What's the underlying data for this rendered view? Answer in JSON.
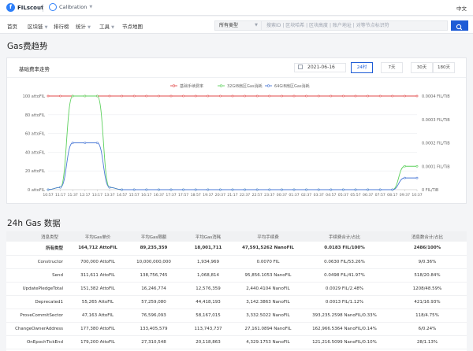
{
  "brand": {
    "name": "FILscout"
  },
  "network": {
    "label": "Calibration"
  },
  "lang": "中文",
  "nav": [
    "首页",
    "区块链",
    "排行榜",
    "统计",
    "工具",
    "节点地图"
  ],
  "search": {
    "type": "所有类型",
    "placeholder": "搜索ID | 区块哈希 | 区块高度 | 账户地址 | 对等节点标识符"
  },
  "gas_trend": {
    "title": "Gas费趋势",
    "chart_title": "基础费率走势",
    "date": "2021-06-16",
    "ranges": [
      "24时",
      "7天",
      "30天",
      "180天"
    ],
    "active_range": "24时"
  },
  "chart_data": {
    "type": "line",
    "x": [
      "10:57",
      "11:17",
      "11:37",
      "12:17",
      "13:17",
      "13:37",
      "14:57",
      "15:57",
      "16:17",
      "16:37",
      "17:37",
      "17:57",
      "18:57",
      "19:37",
      "20:37",
      "21:17",
      "22:37",
      "22:57",
      "23:37",
      "00:37",
      "01:37",
      "02:37",
      "03:37",
      "04:57",
      "05:37",
      "05:57",
      "06:37",
      "07:57",
      "08:17",
      "09:37",
      "10:37"
    ],
    "series": [
      {
        "name": "基础手续费率",
        "axis": "right",
        "unit": "FIL/TiB",
        "color": "#e24a4a",
        "values": [
          0.0004,
          0.0004,
          0.0004,
          0.0004,
          0.0004,
          0.0004,
          0.0004,
          0.0004,
          0.0004,
          0.0004,
          0.0004,
          0.0004,
          0.0004,
          0.0004,
          0.0004,
          0.0004,
          0.0004,
          0.0004,
          0.0004,
          0.0004,
          0.0004,
          0.0004,
          0.0004,
          0.0004,
          0.0004,
          0.0004,
          0.0004,
          0.0004,
          0.0004,
          0.0004,
          0.0004
        ]
      },
      {
        "name": "32GiB扇区Gas消耗",
        "axis": "right",
        "unit": "FIL/TiB",
        "color": "#5cd05c",
        "values": [
          0,
          1e-05,
          0.0004,
          0.0004,
          0.0004,
          1e-05,
          0,
          0,
          0,
          0,
          0,
          0,
          0,
          0,
          0,
          0,
          0,
          0,
          0,
          0,
          0,
          0,
          0,
          0,
          0,
          0,
          0,
          0,
          0,
          0.0001,
          0.0001
        ]
      },
      {
        "name": "64GiB扇区Gas消耗",
        "axis": "right",
        "unit": "FIL/TiB",
        "color": "#4a78d6",
        "values": [
          0,
          1e-05,
          0.0002,
          0.0002,
          0.0002,
          1e-05,
          0,
          0,
          0,
          0,
          0,
          0,
          0,
          0,
          0,
          0,
          0,
          0,
          0,
          0,
          0,
          0,
          0,
          0,
          0,
          0,
          0,
          0,
          0,
          5e-05,
          5e-05
        ]
      }
    ],
    "y_left": {
      "ticks": [
        "0 attoFIL",
        "20 attoFIL",
        "40 attoFIL",
        "60 attoFIL",
        "80 attoFIL",
        "100 attoFIL"
      ],
      "range": [
        0,
        100
      ]
    },
    "y_right": {
      "ticks": [
        "0 FIL/TiB",
        "0.0001 FIL/TiB",
        "0.0002 FIL/TiB",
        "0.0003 FIL/TiB",
        "0.0004 FIL/TiB"
      ],
      "range": [
        0,
        0.0004
      ]
    },
    "legend": "top-center",
    "grid": true
  },
  "gas24": {
    "title": "24h Gas 数据",
    "headers": [
      "消息类型",
      "平均Gas单价",
      "平均Gas限额",
      "平均Gas消耗",
      "平均手续费",
      "手续费合计/占比",
      "消息数合计/占比"
    ],
    "rows": [
      [
        "所有类型",
        "164,712 AttoFIL",
        "89,235,359",
        "18,001,711",
        "47,591,5262 NanoFIL",
        "0.0183 FIL/100%",
        "2486/100%"
      ],
      [
        "Constructor",
        "700,000 AttoFIL",
        "10,000,000,000",
        "1,934,969",
        "0.0070 FIL",
        "0.0630 FIL/53.26%",
        "9/0.36%"
      ],
      [
        "Send",
        "311,611 AttoFIL",
        "138,756,745",
        "1,068,814",
        "95,856.1053 NanoFIL",
        "0.0498 FIL/41.97%",
        "518/20.84%"
      ],
      [
        "UpdatePledgeTotal",
        "151,382 AttoFIL",
        "16,246,774",
        "12,576,359",
        "2,440.4104 NanoFIL",
        "0.0029 FIL/2.48%",
        "1208/48.59%"
      ],
      [
        "Deprecated1",
        "55,265 AttoFIL",
        "57,259,080",
        "44,418,193",
        "3,142.3863 NanoFIL",
        "0.0013 FIL/1.12%",
        "421/16.93%"
      ],
      [
        "ProveCommitSector",
        "47,163 AttoFIL",
        "76,596,093",
        "58,167,015",
        "3,332.5022 NanoFIL",
        "393,235.2598 NanoFIL/0.33%",
        "118/4.75%"
      ],
      [
        "ChangeOwnerAddress",
        "177,380 AttoFIL",
        "133,405,579",
        "113,743,737",
        "27,161.0894 NanoFIL",
        "162,966.5364 NanoFIL/0.14%",
        "6/0.24%"
      ],
      [
        "OnEpochTickEnd",
        "179,200 AttoFIL",
        "27,310,548",
        "20,118,863",
        "4,329.1753 NanoFIL",
        "121,216.5099 NanoFIL/0.10%",
        "28/1.13%"
      ]
    ]
  }
}
